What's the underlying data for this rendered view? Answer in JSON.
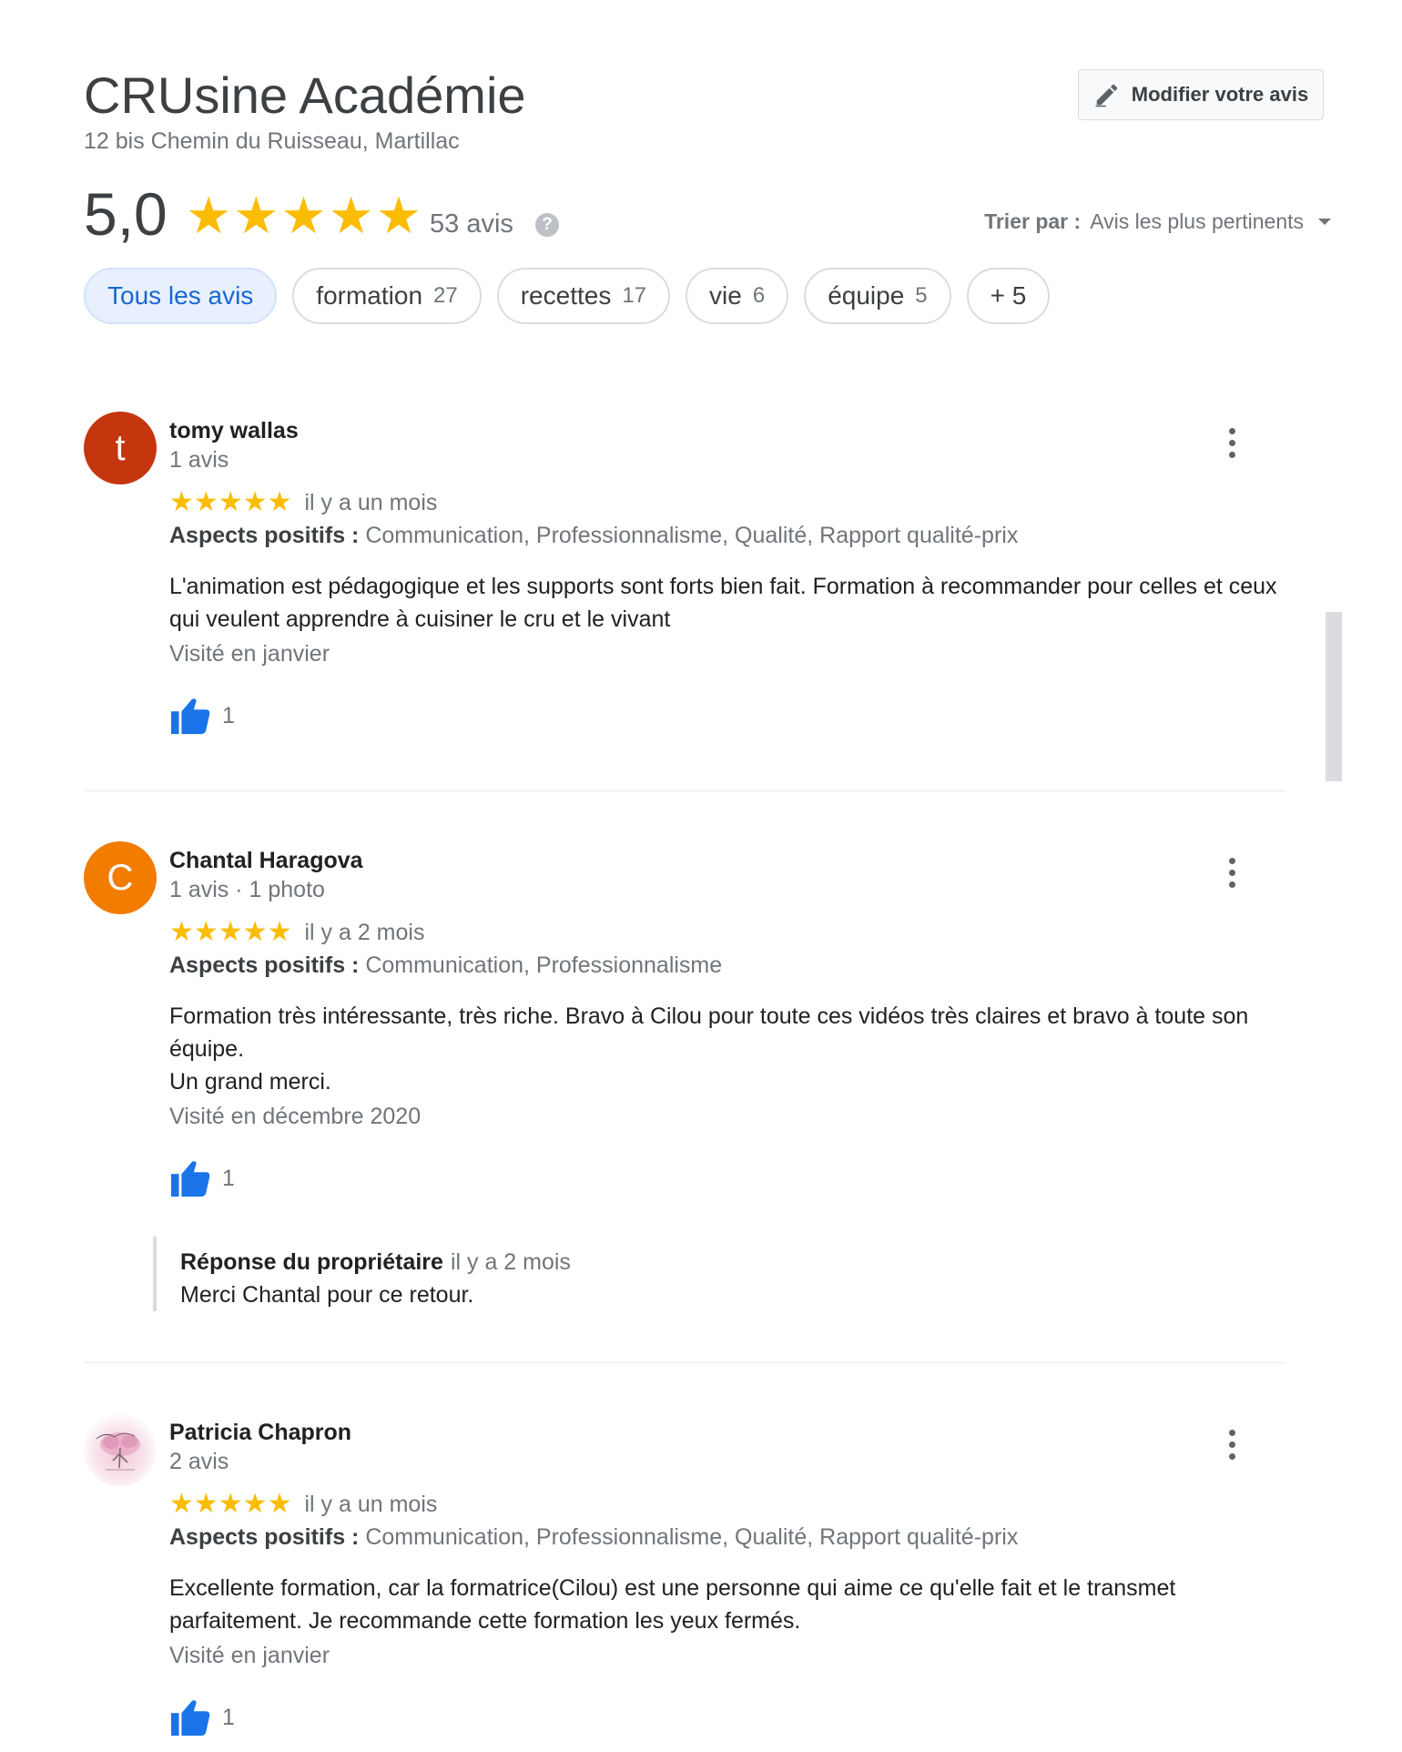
{
  "header": {
    "title": "CRUsine Académie",
    "address": "12 bis Chemin du Ruisseau, Martillac",
    "edit_button": "Modifier votre avis"
  },
  "summary": {
    "score": "5,0",
    "stars": "★★★★★",
    "count": "53 avis",
    "help": "?",
    "sort_label": "Trier par :",
    "sort_value": "Avis les plus pertinents"
  },
  "chips": [
    {
      "label": "Tous les avis",
      "count": ""
    },
    {
      "label": "formation",
      "count": "27"
    },
    {
      "label": "recettes",
      "count": "17"
    },
    {
      "label": "vie",
      "count": "6"
    },
    {
      "label": "équipe",
      "count": "5"
    },
    {
      "label": "+ 5",
      "count": ""
    }
  ],
  "reviews": [
    {
      "avatar_letter": "t",
      "avatar_color": "#c5360e",
      "name": "tomy wallas",
      "meta": "1 avis",
      "stars": "★★★★★",
      "when": "il y a un mois",
      "aspects_label": "Aspects positifs :",
      "aspects": "Communication, Professionnalisme, Qualité, Rapport qualité-prix",
      "text": "L'animation est pédagogique et les supports sont forts bien fait. Formation à recommander pour celles et ceux qui veulent apprendre à cuisiner le cru et le vivant",
      "visited": "Visité en janvier",
      "likes": "1"
    },
    {
      "avatar_letter": "C",
      "avatar_color": "#f17c00",
      "name": "Chantal Haragova",
      "meta": "1 avis · 1 photo",
      "stars": "★★★★★",
      "when": "il y a 2 mois",
      "aspects_label": "Aspects positifs :",
      "aspects": "Communication, Professionnalisme",
      "text": "Formation très intéressante, très riche. Bravo à Cilou pour toute ces vidéos très claires et bravo à toute son équipe.\nUn grand merci.",
      "visited": "Visité en décembre 2020",
      "likes": "1",
      "owner_reply": {
        "title": "Réponse du propriétaire",
        "when": "il y a 2 mois",
        "text": "Merci Chantal pour ce retour."
      }
    },
    {
      "name": "Patricia Chapron",
      "meta": "2 avis",
      "stars": "★★★★★",
      "when": "il y a un mois",
      "aspects_label": "Aspects positifs :",
      "aspects": "Communication, Professionnalisme, Qualité, Rapport qualité-prix",
      "text": "Excellente formation, car la formatrice(Cilou) est une personne qui aime ce qu'elle fait et le transmet parfaitement. Je recommande cette formation les yeux fermés.",
      "visited": "Visité en janvier",
      "likes": "1"
    }
  ],
  "colors": {
    "star": "#fbbc04",
    "thumb": "#1a73e8",
    "chip_active_bg": "#e8f0fe",
    "chip_active_text": "#1967d2"
  }
}
